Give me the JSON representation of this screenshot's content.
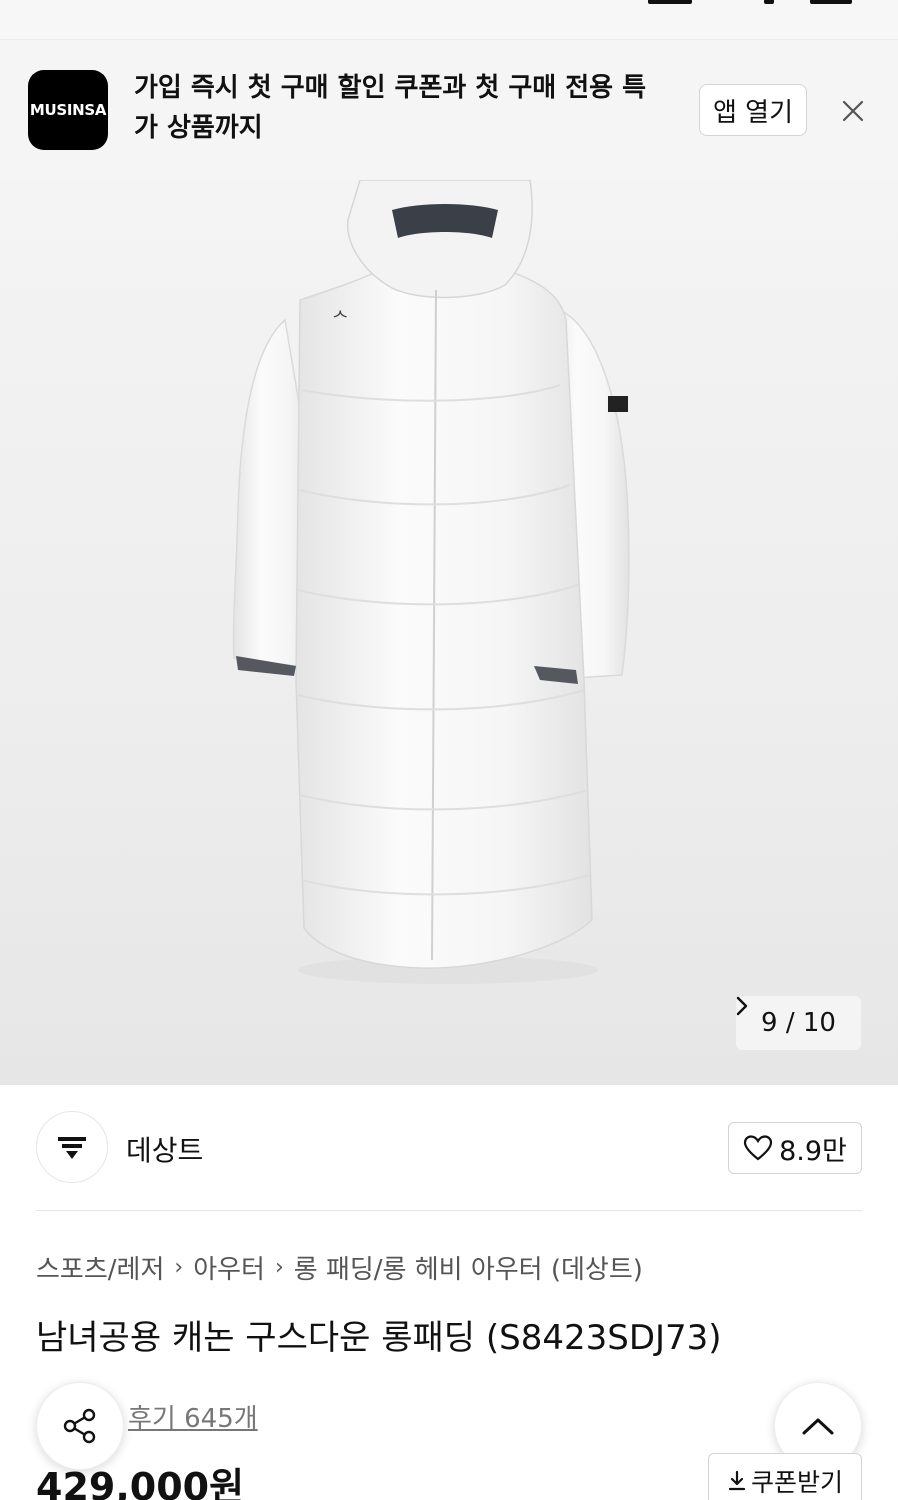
{
  "banner": {
    "logo_text": "MUSINSA",
    "message_line1": "가입 즉시 첫 구매 할인 쿠폰과 첫 구매 전용 특",
    "message_line2": "가 상품까지",
    "open_app_label": "앱 열기",
    "close_icon": "close-icon"
  },
  "gallery": {
    "image_subject": "white long puffer down jacket",
    "counter": "9 / 10",
    "next_icon": "chevron-right-icon"
  },
  "brand": {
    "name": "데상트",
    "logo_icon": "descente-logo-icon",
    "like_icon": "heart-icon",
    "like_count": "8.9만"
  },
  "breadcrumb": {
    "items": [
      "스포츠/레저",
      "아우터",
      "롱 패딩/롱 헤비 아우터 (데상트)"
    ],
    "separator_icon": "chevron-right-icon"
  },
  "product": {
    "title": "남녀공용 캐논 구스다운 롱패딩 (S8423SDJ73)",
    "reviews": "후기 645개",
    "price": "429,000원"
  },
  "actions": {
    "share_icon": "share-icon",
    "scroll_top_icon": "chevron-up-icon",
    "coupon_label": "쿠폰받기",
    "coupon_icon": "download-icon"
  },
  "colors": {
    "text": "#111111",
    "muted": "#777777",
    "banner_bg": "#f5f5f5",
    "border": "#d4d4d4"
  }
}
